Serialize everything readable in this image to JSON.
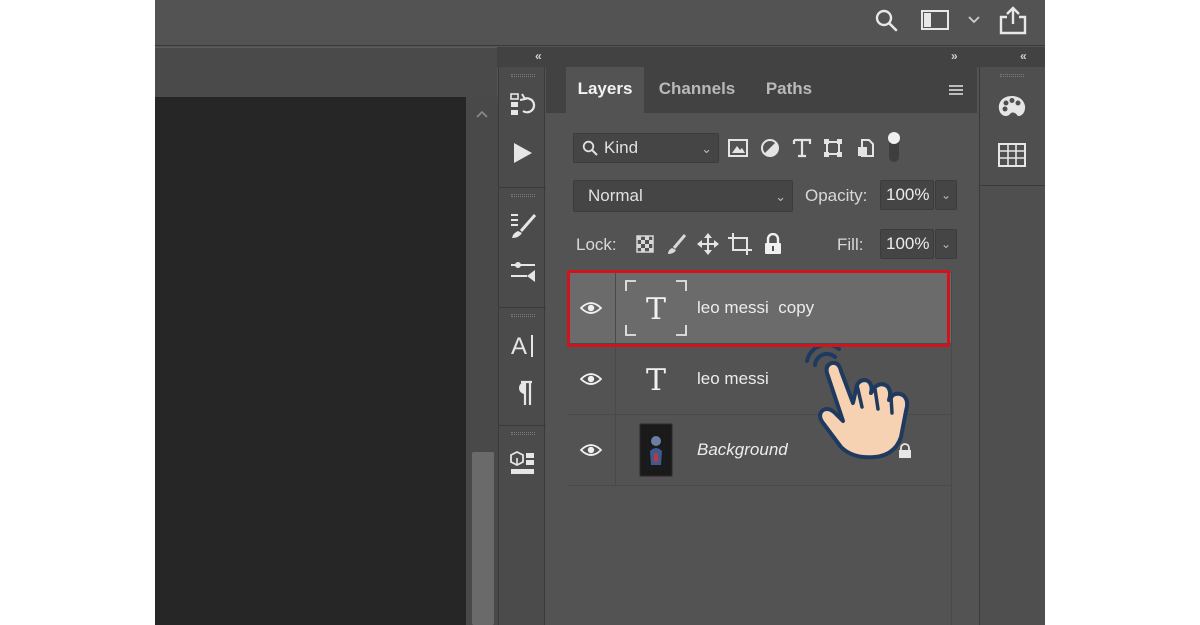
{
  "toolbar": {
    "search_icon": "search-icon",
    "workspace_icon": "workspace-icon",
    "share_icon": "share-icon"
  },
  "collapse": {
    "left": "«",
    "right_expand": "»",
    "right_collapse": "«"
  },
  "panel": {
    "tabs": [
      {
        "label": "Layers",
        "active": true
      },
      {
        "label": "Channels",
        "active": false
      },
      {
        "label": "Paths",
        "active": false
      }
    ],
    "filter": {
      "kind_label": "Kind",
      "filter_icons": [
        "image-filter-icon",
        "adjustment-filter-icon",
        "type-filter-icon",
        "shape-filter-icon",
        "smart-object-filter-icon"
      ]
    },
    "blend": {
      "mode": "Normal",
      "opacity_label": "Opacity:",
      "opacity_value": "100%"
    },
    "lock": {
      "lock_label": "Lock:",
      "fill_label": "Fill:",
      "fill_value": "100%",
      "lock_icons": [
        "lock-transparency-icon",
        "lock-image-icon",
        "lock-position-icon",
        "lock-artboard-icon",
        "lock-all-icon"
      ]
    },
    "layers": [
      {
        "name": "leo messi  copy",
        "type": "text",
        "visible": true,
        "selected": true
      },
      {
        "name": "leo messi",
        "type": "text",
        "visible": true,
        "selected": false
      },
      {
        "name": "Background",
        "type": "image",
        "visible": true,
        "selected": false,
        "locked": true
      }
    ]
  },
  "colors": {
    "highlight": "#d0131c",
    "panel_bg": "#535353",
    "canvas_bg": "#262626",
    "hand_skin": "#f7d2b2",
    "hand_outline": "#1e3a5f"
  }
}
